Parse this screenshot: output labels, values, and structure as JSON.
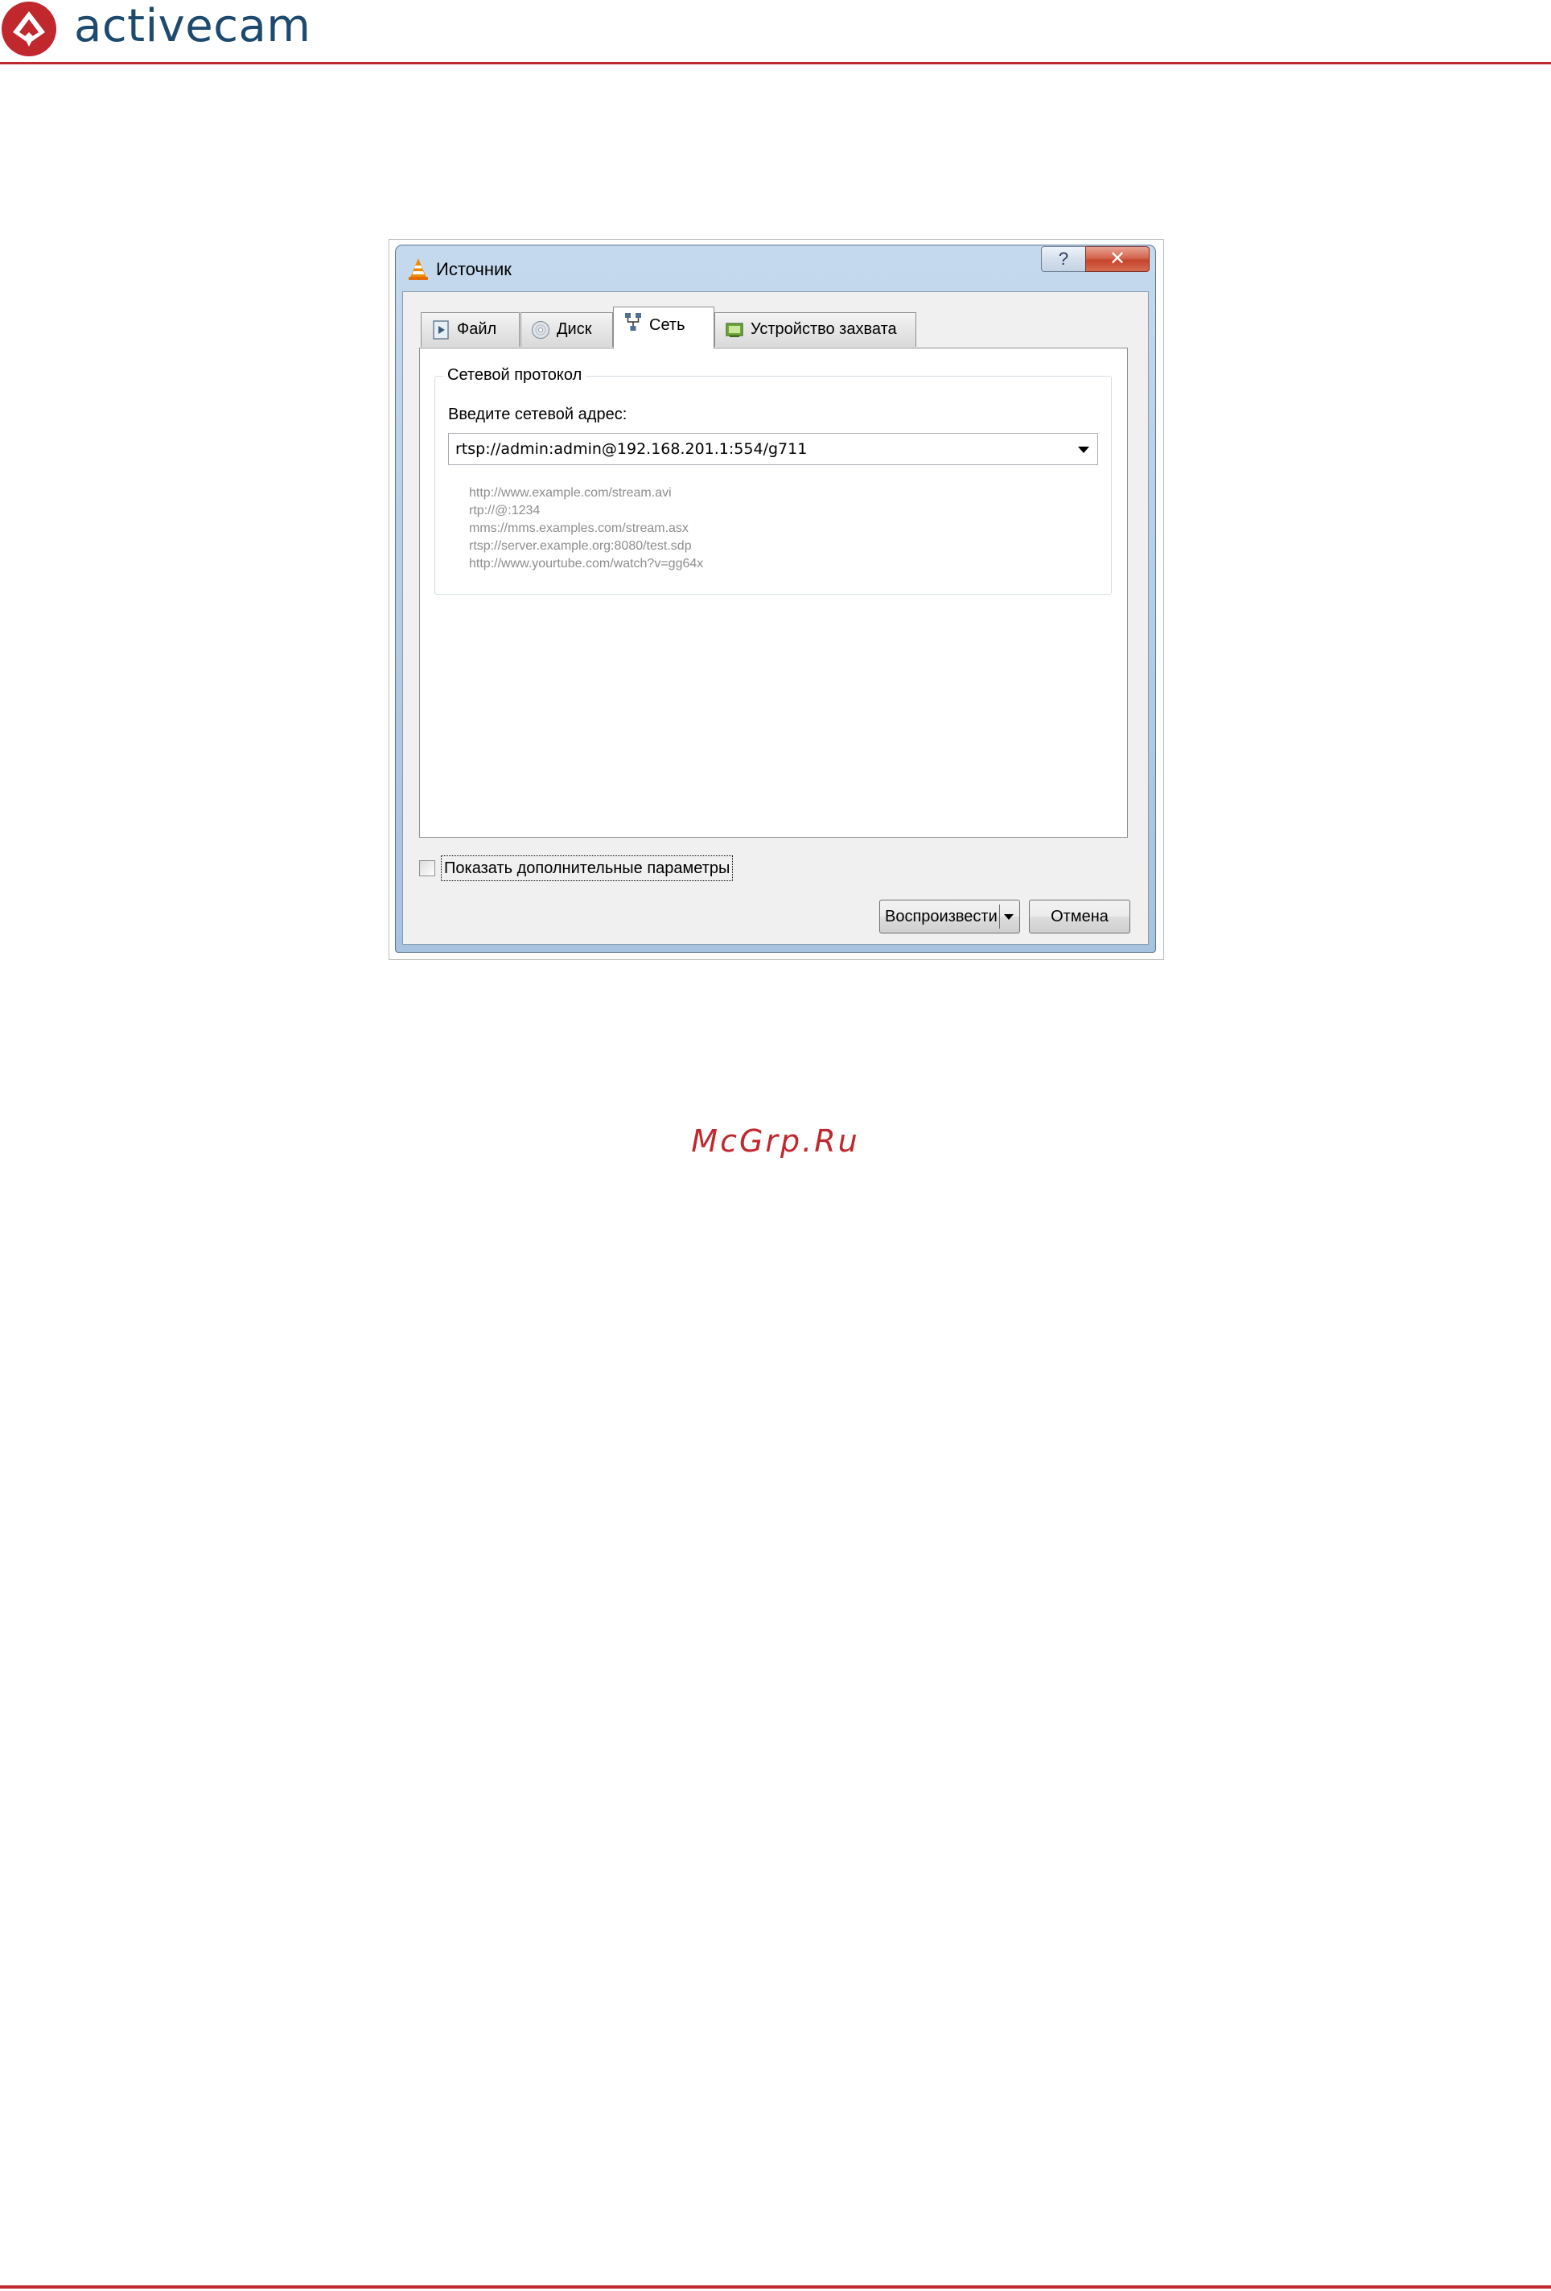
{
  "header": {
    "brand": "activecam",
    "brand_color": "#1d4a6e",
    "accent_color": "#c0282d"
  },
  "watermark": "McGrp.Ru",
  "dialog": {
    "title": "Источник",
    "icon": "vlc-cone-icon",
    "help_label": "?",
    "close_label": "✕",
    "tabs": [
      {
        "label": "Файл",
        "icon": "file-play-icon",
        "active": false
      },
      {
        "label": "Диск",
        "icon": "disc-icon",
        "active": false
      },
      {
        "label": "Сеть",
        "icon": "network-icon",
        "active": true
      },
      {
        "label": "Устройство захвата",
        "icon": "capture-device-icon",
        "active": false
      }
    ],
    "network": {
      "group_title": "Сетевой протокол",
      "address_label": "Введите сетевой адрес:",
      "address_value": "rtsp://admin:admin@192.168.201.1:554/g711",
      "examples": [
        "http://www.example.com/stream.avi",
        "rtp://@:1234",
        "mms://mms.examples.com/stream.asx",
        "rtsp://server.example.org:8080/test.sdp",
        "http://www.yourtube.com/watch?v=gg64x"
      ]
    },
    "show_more_options": {
      "label": "Показать дополнительные параметры",
      "checked": false
    },
    "play_button": "Воспроизвести",
    "cancel_button": "Отмена"
  }
}
